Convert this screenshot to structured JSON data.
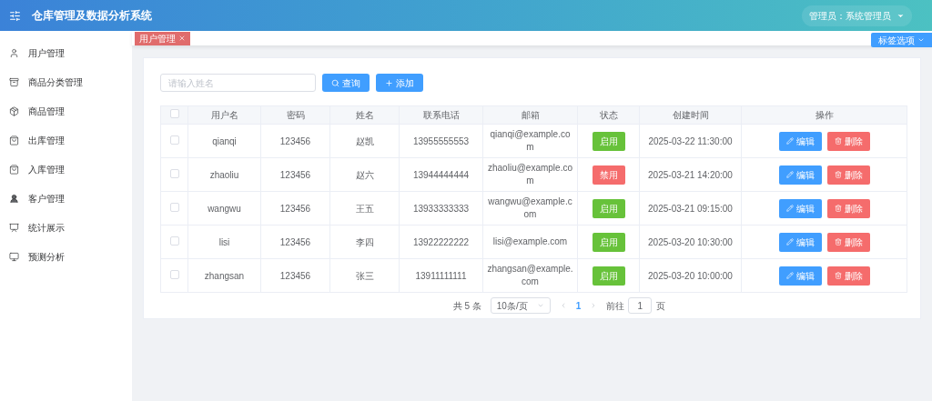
{
  "header": {
    "title": "仓库管理及数据分析系统",
    "user": "管理员：系统管理员"
  },
  "sidebar": {
    "items": [
      {
        "label": "用户管理"
      },
      {
        "label": "商品分类管理"
      },
      {
        "label": "商品管理"
      },
      {
        "label": "出库管理"
      },
      {
        "label": "入库管理"
      },
      {
        "label": "客户管理"
      },
      {
        "label": "统计展示"
      },
      {
        "label": "预测分析"
      }
    ]
  },
  "tabs": [
    {
      "label": "用户管理",
      "selected": true
    }
  ],
  "tab_options": "标签选项",
  "search": {
    "placeholder": "请输入姓名"
  },
  "buttons": {
    "query": "查询",
    "add": "添加"
  },
  "table": {
    "select_all": {
      "checked": false
    },
    "columns": [
      "用户名",
      "密码",
      "姓名",
      "联系电话",
      "邮箱",
      "状态",
      "创建时间",
      "操作"
    ],
    "rows": [
      {
        "checked": false,
        "username": "qianqi",
        "password": "123456",
        "name": "赵凯",
        "phone": "13955555553",
        "email": "qianqi@example.com",
        "status": {
          "label": "启用",
          "kind": "enabled"
        },
        "created": "2025-03-22 11:30:00",
        "edit": "编辑",
        "delete": "删除"
      },
      {
        "checked": false,
        "username": "zhaoliu",
        "password": "123456",
        "name": "赵六",
        "phone": "13944444444",
        "email": "zhaoliu@example.com",
        "status": {
          "label": "禁用",
          "kind": "disabled"
        },
        "created": "2025-03-21 14:20:00",
        "edit": "编辑",
        "delete": "删除"
      },
      {
        "checked": false,
        "username": "wangwu",
        "password": "123456",
        "name": "王五",
        "phone": "13933333333",
        "email": "wangwu@example.com",
        "status": {
          "label": "启用",
          "kind": "enabled"
        },
        "created": "2025-03-21 09:15:00",
        "edit": "编辑",
        "delete": "删除"
      },
      {
        "checked": false,
        "username": "lisi",
        "password": "123456",
        "name": "李四",
        "phone": "13922222222",
        "email": "lisi@example.com",
        "status": {
          "label": "启用",
          "kind": "enabled"
        },
        "created": "2025-03-20 10:30:00",
        "edit": "编辑",
        "delete": "删除"
      },
      {
        "checked": false,
        "username": "zhangsan",
        "password": "123456",
        "name": "张三",
        "phone": "13911111111",
        "email": "zhangsan@example.com",
        "status": {
          "label": "启用",
          "kind": "enabled"
        },
        "created": "2025-03-20 10:00:00",
        "edit": "编辑",
        "delete": "删除"
      }
    ]
  },
  "pagination": {
    "total": "共 5 条",
    "page_size": "10条/页",
    "pages": [
      {
        "label": "1",
        "selected": true
      }
    ],
    "goto_label": "前往",
    "goto_value": "1",
    "page_unit": "页"
  }
}
